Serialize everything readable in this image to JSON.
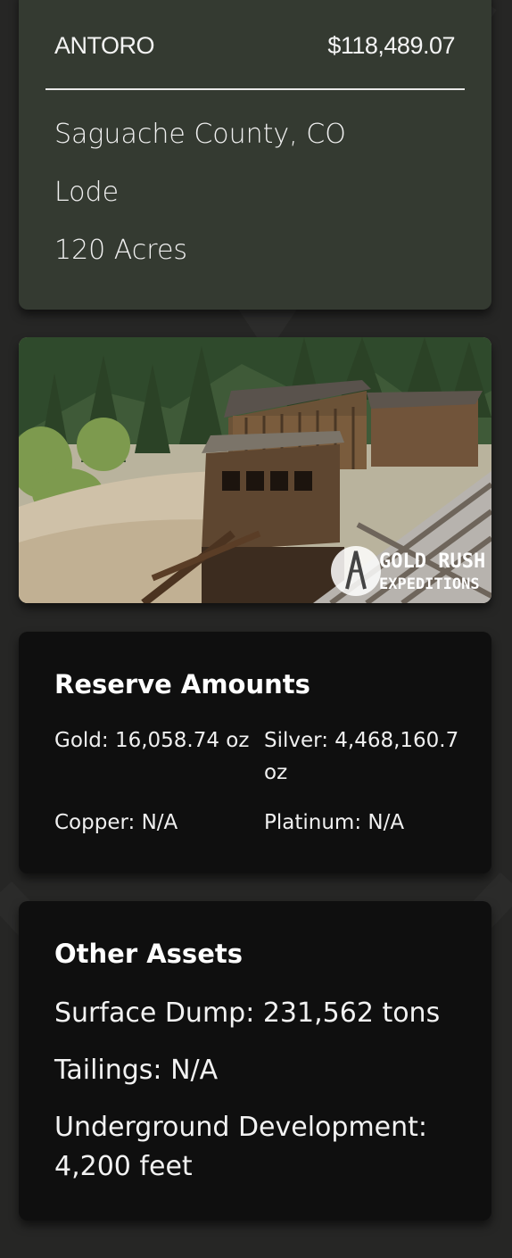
{
  "property": {
    "name": "ANTORO",
    "price": "$118,489.07",
    "location": "Saguache County, CO",
    "claim_type": "Lode",
    "acreage": "120 Acres"
  },
  "photo": {
    "watermark_line1": "GOLD RUSH",
    "watermark_line2": "EXPEDITIONS"
  },
  "reserves": {
    "title": "Reserve Amounts",
    "gold": "Gold: 16,058.74 oz",
    "silver": "Silver: 4,468,160.7 oz",
    "copper": "Copper: N/A",
    "platinum": "Platinum: N/A"
  },
  "assets": {
    "title": "Other Assets",
    "surface_dump": "Surface Dump: 231,562 tons",
    "tailings": "Tailings: N/A",
    "underground": "Underground Development: 4,200 feet"
  },
  "colors": {
    "page_background": "#262625",
    "header_card": "#343a31",
    "dark_card": "#0f0f0f",
    "text": "#f2f2f2"
  }
}
